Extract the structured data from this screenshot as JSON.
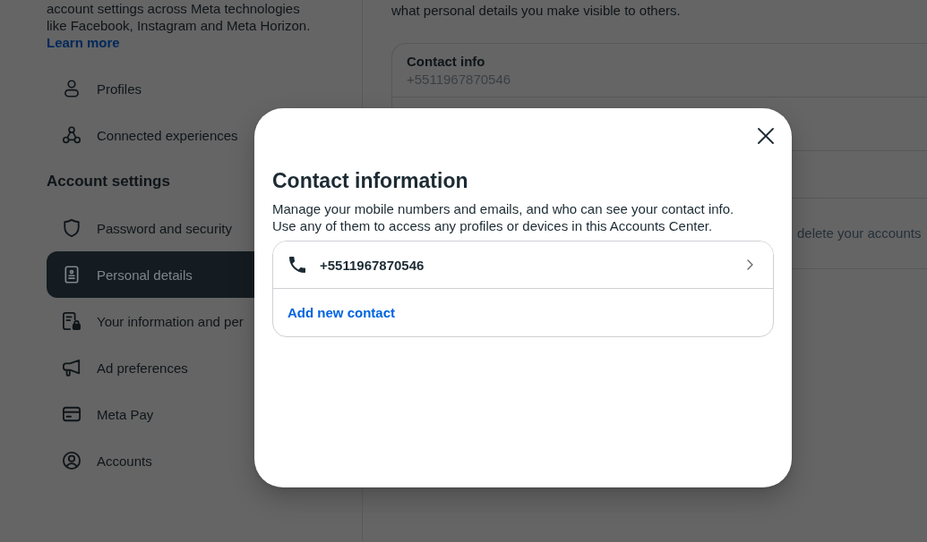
{
  "sidebar": {
    "intro_text": "account settings across Meta technologies like Facebook, Instagram and Meta Horizon.",
    "learn_more_link": "Learn more",
    "top_items": [
      {
        "label": "Profiles",
        "selected": false
      },
      {
        "label": "Connected experiences",
        "selected": false
      }
    ],
    "account_settings": {
      "heading": "Account settings",
      "items": [
        {
          "label": "Password and security",
          "selected": false
        },
        {
          "label": "Personal details",
          "selected": true
        },
        {
          "label": "Your information and per",
          "selected": false
        },
        {
          "label": "Ad preferences",
          "selected": false
        },
        {
          "label": "Meta Pay",
          "selected": false
        },
        {
          "label": "Accounts",
          "selected": false
        }
      ]
    }
  },
  "main": {
    "intro_text": "what personal details you make visible to others.",
    "card": {
      "contact_info": {
        "title": "Contact info",
        "value": "+5511967870546"
      },
      "row_4_text": "delete your accounts"
    }
  },
  "dialog": {
    "title": "Contact information",
    "description": "Manage your mobile numbers and emails, and who can see your contact info. Use any of them to access any profiles or devices in this Accounts Center.",
    "contacts": [
      {
        "kind": "phone",
        "value": "+5511967870546"
      }
    ],
    "add_contact_link": "Add new contact"
  }
}
